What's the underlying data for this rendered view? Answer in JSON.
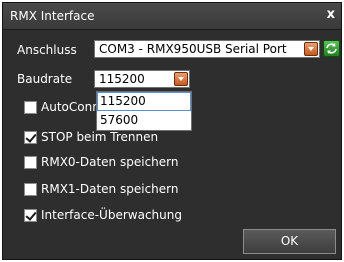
{
  "window": {
    "title": "RMX Interface",
    "close_label": "x"
  },
  "port": {
    "label": "Anschluss",
    "value": "COM3 - RMX950USB Serial Port"
  },
  "baud": {
    "label": "Baudrate",
    "value": "115200",
    "options": [
      "115200",
      "57600"
    ]
  },
  "options": [
    {
      "label": "AutoConn",
      "checked": false
    },
    {
      "label": "STOP beim Trennen",
      "checked": true
    },
    {
      "label": "RMX0-Daten speichern",
      "checked": false
    },
    {
      "label": "RMX1-Daten speichern",
      "checked": false
    },
    {
      "label": "Interface-Überwachung",
      "checked": true
    }
  ],
  "ok_label": "OK",
  "colors": {
    "window_bg": "#2e2e2e",
    "dropdown_arrow": "#c45a20",
    "refresh": "#1f7f1f"
  },
  "icons": {
    "refresh": "refresh-icon",
    "dropdown": "chevron-down-icon",
    "close": "close-icon"
  }
}
